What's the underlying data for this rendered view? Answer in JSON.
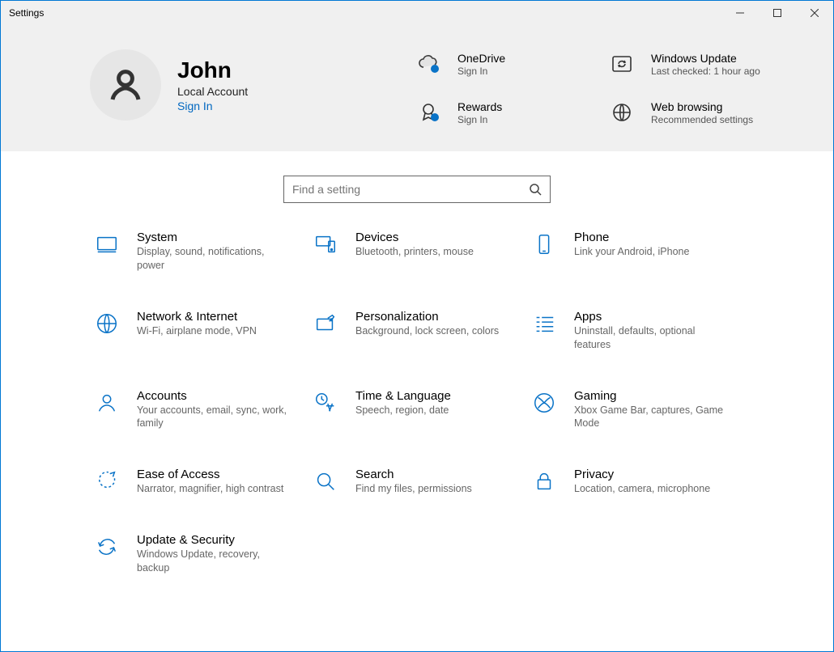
{
  "window": {
    "title": "Settings"
  },
  "account": {
    "name": "John",
    "type": "Local Account",
    "signin": "Sign In"
  },
  "hero": [
    {
      "id": "onedrive",
      "title": "OneDrive",
      "subtitle": "Sign In"
    },
    {
      "id": "windows-update",
      "title": "Windows Update",
      "subtitle": "Last checked: 1 hour ago"
    },
    {
      "id": "rewards",
      "title": "Rewards",
      "subtitle": "Sign In"
    },
    {
      "id": "web-browsing",
      "title": "Web browsing",
      "subtitle": "Recommended settings"
    }
  ],
  "search": {
    "placeholder": "Find a setting"
  },
  "categories": [
    {
      "id": "system",
      "title": "System",
      "desc": "Display, sound, notifications, power"
    },
    {
      "id": "devices",
      "title": "Devices",
      "desc": "Bluetooth, printers, mouse"
    },
    {
      "id": "phone",
      "title": "Phone",
      "desc": "Link your Android, iPhone"
    },
    {
      "id": "network",
      "title": "Network & Internet",
      "desc": "Wi-Fi, airplane mode, VPN"
    },
    {
      "id": "personalization",
      "title": "Personalization",
      "desc": "Background, lock screen, colors"
    },
    {
      "id": "apps",
      "title": "Apps",
      "desc": "Uninstall, defaults, optional features"
    },
    {
      "id": "accounts",
      "title": "Accounts",
      "desc": "Your accounts, email, sync, work, family"
    },
    {
      "id": "time-language",
      "title": "Time & Language",
      "desc": "Speech, region, date"
    },
    {
      "id": "gaming",
      "title": "Gaming",
      "desc": "Xbox Game Bar, captures, Game Mode"
    },
    {
      "id": "ease-of-access",
      "title": "Ease of Access",
      "desc": "Narrator, magnifier, high contrast"
    },
    {
      "id": "search",
      "title": "Search",
      "desc": "Find my files, permissions"
    },
    {
      "id": "privacy",
      "title": "Privacy",
      "desc": "Location, camera, microphone"
    },
    {
      "id": "update-security",
      "title": "Update & Security",
      "desc": "Windows Update, recovery, backup"
    }
  ],
  "colors": {
    "accent": "#0a73c7",
    "link": "#0067c0"
  }
}
